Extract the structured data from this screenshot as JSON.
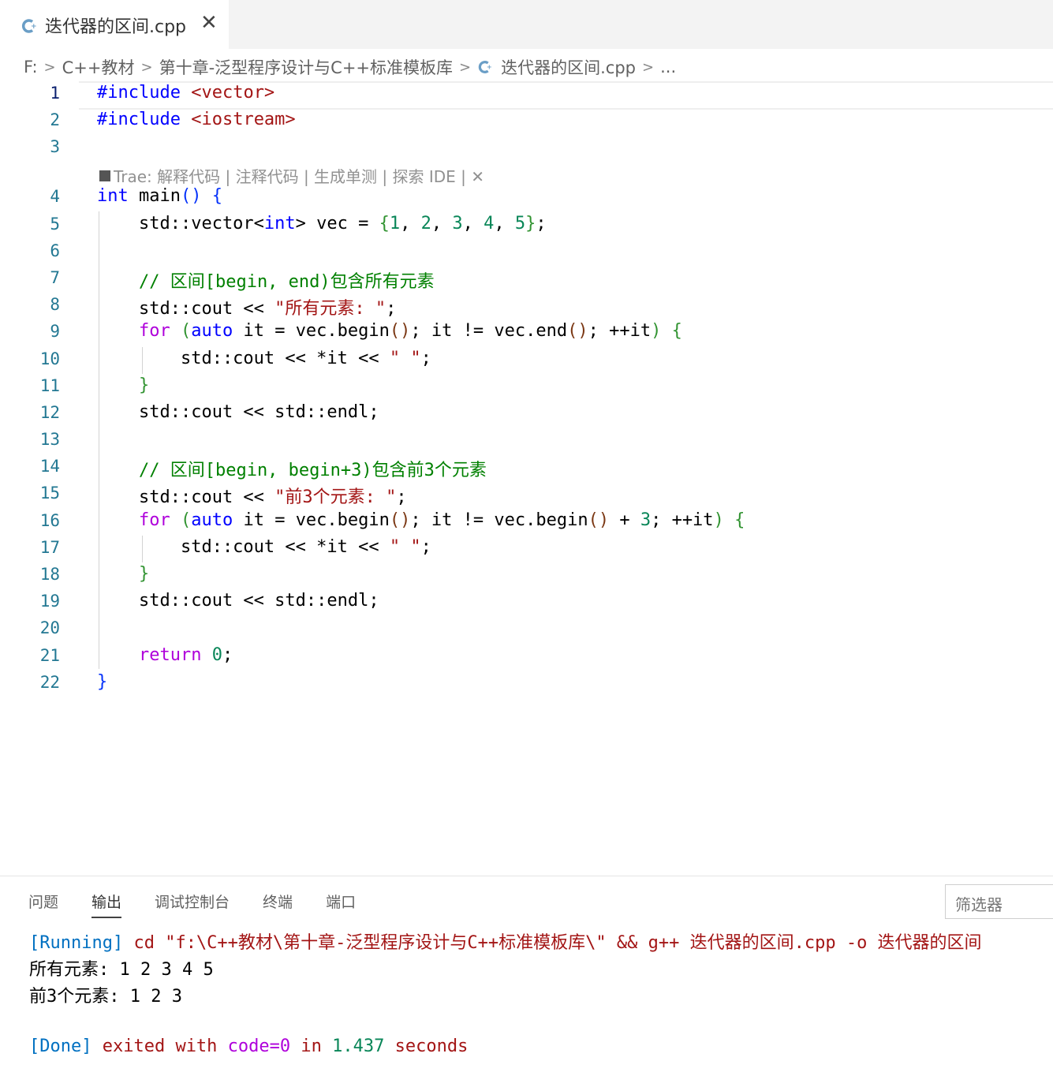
{
  "tab": {
    "label": "迭代器的区间.cpp",
    "close": "✕"
  },
  "breadcrumb": {
    "items": [
      "F:",
      "C++教材",
      "第十章-泛型程序设计与C++标准模板库",
      "迭代器的区间.cpp",
      "..."
    ],
    "separator": ">"
  },
  "editor": {
    "line_numbers": [
      "1",
      "2",
      "3",
      "4",
      "5",
      "6",
      "7",
      "8",
      "9",
      "10",
      "11",
      "12",
      "13",
      "14",
      "15",
      "16",
      "17",
      "18",
      "19",
      "20",
      "21",
      "22"
    ],
    "active_line": "1",
    "codelens": "Trae: 解释代码 | 注释代码 | 生成单测 | 探索 IDE | ✕",
    "lines": [
      [
        {
          "t": "#include ",
          "c": "t"
        },
        {
          "t": "<vector>",
          "c": "s"
        }
      ],
      [
        {
          "t": "#include ",
          "c": "t"
        },
        {
          "t": "<iostream>",
          "c": "s"
        }
      ],
      [],
      [
        {
          "t": "int",
          "c": "k"
        },
        {
          "t": " main"
        },
        {
          "t": "()",
          "c": "p1"
        },
        {
          "t": " "
        },
        {
          "t": "{",
          "c": "p1"
        }
      ],
      [
        {
          "t": "    std::vector<"
        },
        {
          "t": "int",
          "c": "k"
        },
        {
          "t": "> vec = "
        },
        {
          "t": "{",
          "c": "p2"
        },
        {
          "t": "1",
          "c": "n"
        },
        {
          "t": ", "
        },
        {
          "t": "2",
          "c": "n"
        },
        {
          "t": ", "
        },
        {
          "t": "3",
          "c": "n"
        },
        {
          "t": ", "
        },
        {
          "t": "4",
          "c": "n"
        },
        {
          "t": ", "
        },
        {
          "t": "5",
          "c": "n"
        },
        {
          "t": "}",
          "c": "p2"
        },
        {
          "t": ";"
        }
      ],
      [],
      [
        {
          "t": "    // 区间[begin, end)包含所有元素",
          "c": "c"
        }
      ],
      [
        {
          "t": "    std::cout << "
        },
        {
          "t": "\"所有元素: \"",
          "c": "s"
        },
        {
          "t": ";"
        }
      ],
      [
        {
          "t": "    "
        },
        {
          "t": "for",
          "c": "kc"
        },
        {
          "t": " "
        },
        {
          "t": "(",
          "c": "p2"
        },
        {
          "t": "auto",
          "c": "k"
        },
        {
          "t": " it = vec.begin"
        },
        {
          "t": "()",
          "c": "p3"
        },
        {
          "t": "; it != vec.end"
        },
        {
          "t": "()",
          "c": "p3"
        },
        {
          "t": "; ++it"
        },
        {
          "t": ")",
          "c": "p2"
        },
        {
          "t": " "
        },
        {
          "t": "{",
          "c": "p2"
        }
      ],
      [
        {
          "t": "        std::cout << *it << "
        },
        {
          "t": "\" \"",
          "c": "s"
        },
        {
          "t": ";"
        }
      ],
      [
        {
          "t": "    "
        },
        {
          "t": "}",
          "c": "p2"
        }
      ],
      [
        {
          "t": "    std::cout << std::endl;"
        }
      ],
      [],
      [
        {
          "t": "    // 区间[begin, begin+3)包含前3个元素",
          "c": "c"
        }
      ],
      [
        {
          "t": "    std::cout << "
        },
        {
          "t": "\"前3个元素: \"",
          "c": "s"
        },
        {
          "t": ";"
        }
      ],
      [
        {
          "t": "    "
        },
        {
          "t": "for",
          "c": "kc"
        },
        {
          "t": " "
        },
        {
          "t": "(",
          "c": "p2"
        },
        {
          "t": "auto",
          "c": "k"
        },
        {
          "t": " it = vec.begin"
        },
        {
          "t": "()",
          "c": "p3"
        },
        {
          "t": "; it != vec.begin"
        },
        {
          "t": "()",
          "c": "p3"
        },
        {
          "t": " + "
        },
        {
          "t": "3",
          "c": "n"
        },
        {
          "t": "; ++it"
        },
        {
          "t": ")",
          "c": "p2"
        },
        {
          "t": " "
        },
        {
          "t": "{",
          "c": "p2"
        }
      ],
      [
        {
          "t": "        std::cout << *it << "
        },
        {
          "t": "\" \"",
          "c": "s"
        },
        {
          "t": ";"
        }
      ],
      [
        {
          "t": "    "
        },
        {
          "t": "}",
          "c": "p2"
        }
      ],
      [
        {
          "t": "    std::cout << std::endl;"
        }
      ],
      [],
      [
        {
          "t": "    "
        },
        {
          "t": "return",
          "c": "kc"
        },
        {
          "t": " "
        },
        {
          "t": "0",
          "c": "n"
        },
        {
          "t": ";"
        }
      ],
      [
        {
          "t": "}",
          "c": "p1"
        }
      ]
    ]
  },
  "panel": {
    "tabs": [
      "问题",
      "输出",
      "调试控制台",
      "终端",
      "端口"
    ],
    "active_tab": "输出",
    "filter_placeholder": "筛选器",
    "output": [
      [
        {
          "t": "[Running]",
          "c": "o-blue"
        },
        {
          "t": " cd \"f:\\C++教材\\第十章-泛型程序设计与C++标准模板库\\\" && g++ 迭代器的区间.cpp -o 迭代器的区间",
          "c": "o-red"
        }
      ],
      [
        {
          "t": "所有元素: 1 2 3 4 5"
        }
      ],
      [
        {
          "t": "前3个元素: 1 2 3"
        }
      ],
      [],
      [
        {
          "t": "[Done]",
          "c": "o-blue"
        },
        {
          "t": " exited with ",
          "c": "o-red"
        },
        {
          "t": "code=0",
          "c": "kc"
        },
        {
          "t": " in ",
          "c": "o-red"
        },
        {
          "t": "1.437",
          "c": "o-teal"
        },
        {
          "t": " seconds",
          "c": "o-red"
        }
      ]
    ]
  },
  "colors": {
    "keyword": "#0000ff",
    "string": "#a31515",
    "number": "#098658",
    "comment": "#008000",
    "line_number": "#237893"
  }
}
